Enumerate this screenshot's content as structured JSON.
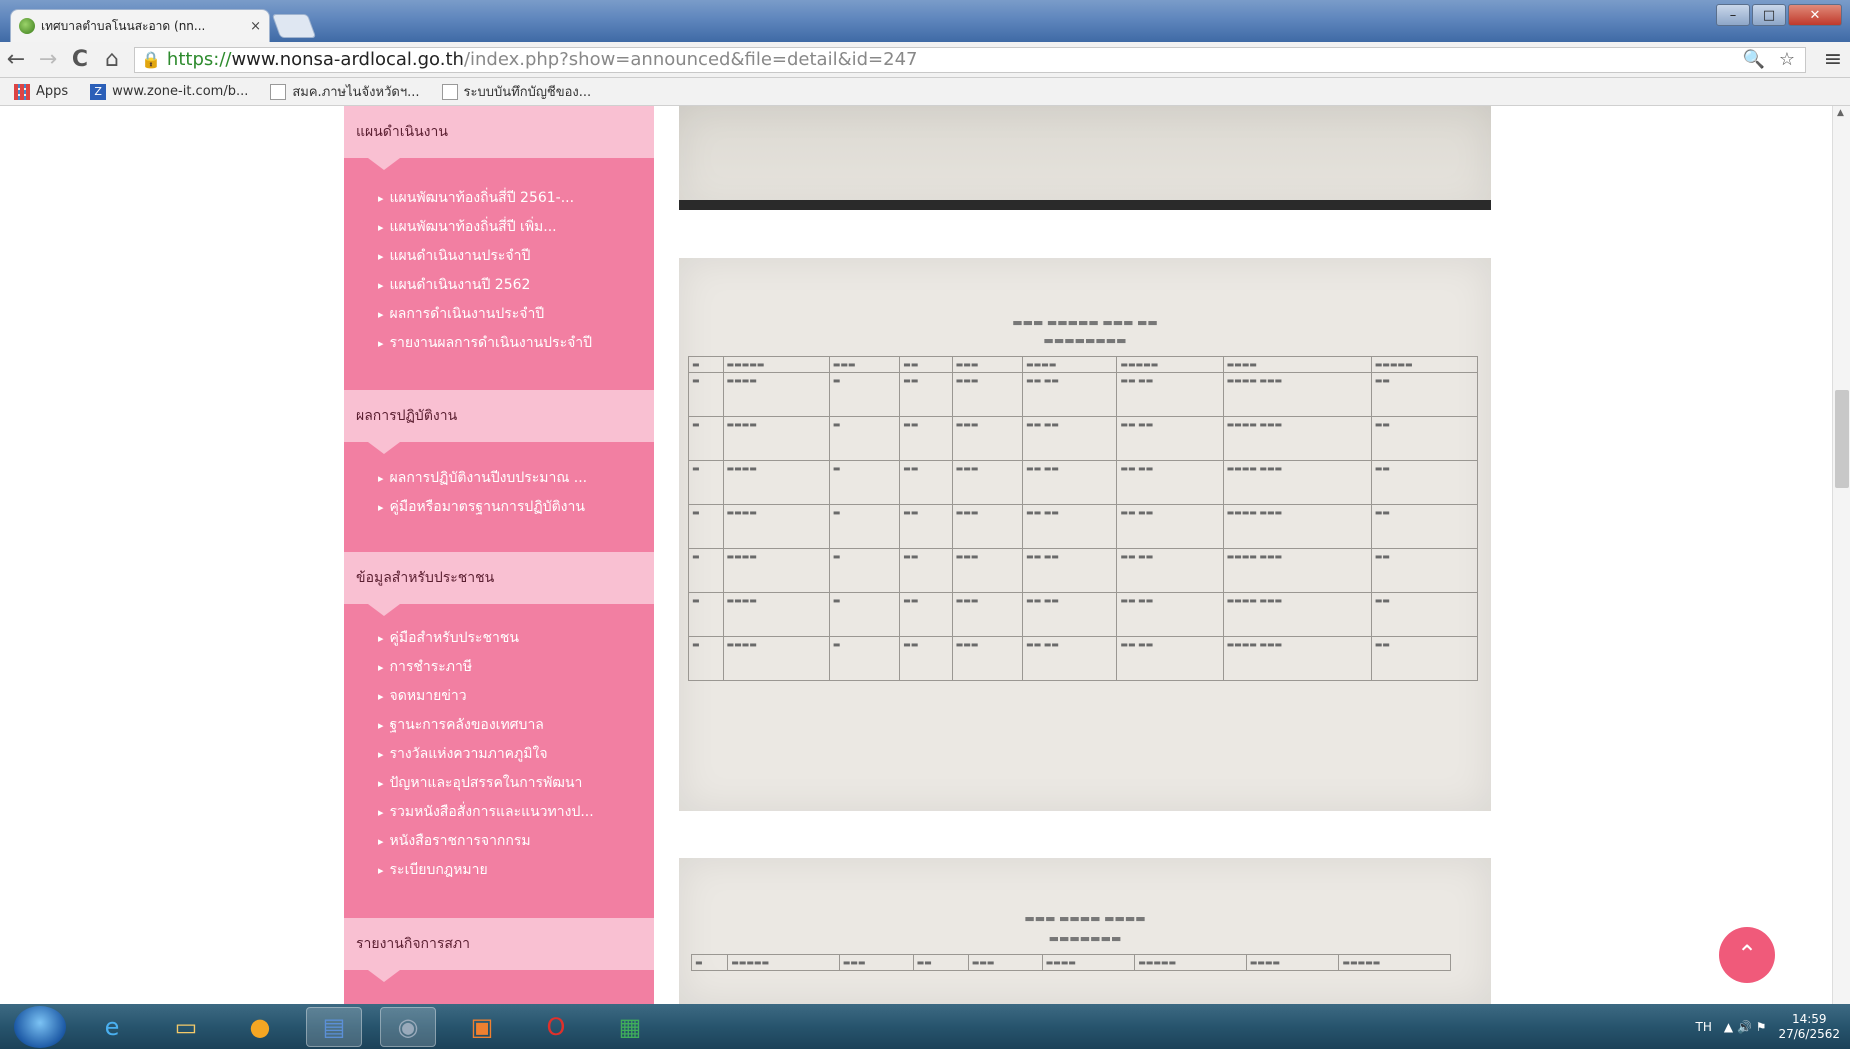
{
  "browser": {
    "tab_title": "เทศบาลตำบลโนนสะอาด (nn...",
    "tab_close": "×",
    "url_scheme": "https://",
    "url_host": "www.nonsa-ardlocal.go.th",
    "url_path": "/index.php?show=announced&file=detail&id=247",
    "nav_back": "←",
    "nav_forward": "→",
    "nav_reload": "C",
    "nav_home": "⌂",
    "lock_icon": "🔒",
    "url_icons": "🔍 ☆",
    "menu_icon": "≡",
    "bookmarks": [
      {
        "label": "Apps",
        "icon": "apps-icon"
      },
      {
        "label": "www.zone-it.com/b...",
        "icon": "z-icon"
      },
      {
        "label": "สมค.ภาษไนจังหวัดฯ...",
        "icon": "page-icon"
      },
      {
        "label": "ระบบบันทึกบัญชีของ...",
        "icon": "page-icon"
      }
    ]
  },
  "sidebar": {
    "sections": [
      {
        "title": "แผนดำเนินงาน",
        "items": [
          "แผนพัฒนาท้องถิ่นสี่ปี 2561-...",
          "แผนพัฒนาท้องถิ่นสี่ปี เพิ่ม...",
          "แผนดำเนินงานประจำปี",
          "แผนดำเนินงานปี 2562",
          "ผลการดำเนินงานประจำปี",
          "รายงานผลการดำเนินงานประจำปี"
        ]
      },
      {
        "title": "ผลการปฏิบัติงาน",
        "items": [
          "ผลการปฏิบัติงานปีงบประมาณ ...",
          "คู่มือหรือมาตรฐานการปฏิบัติงาน"
        ]
      },
      {
        "title": "ข้อมูลสำหรับประชาชน",
        "items": [
          "คู่มือสำหรับประชาชน",
          "การชำระภาษี",
          "จดหมายข่าว",
          "ฐานะการคลังของเทศบาล",
          "รางวัลแห่งความภาคภูมิใจ",
          "ปัญหาและอุปสรรคในการพัฒนา",
          "รวมหนังสือสั่งการและแนวทางป...",
          "หนังสือราชการจากกรม",
          "ระเบียบกฎหมาย"
        ]
      },
      {
        "title": "รายงานกิจการสภา",
        "items": []
      }
    ]
  },
  "to_top_icon": "⌃",
  "taskbar": {
    "tray_lang": "TH",
    "tray_icons": "▲ 🔊 ⚑",
    "time": "14:59",
    "date": "27/6/2562"
  },
  "colors": {
    "sidebar_bg": "#f27fa2",
    "section_head_bg": "#f9c0d2",
    "to_top_button": "#f05a7a",
    "url_secure": "#2e8b2e"
  }
}
